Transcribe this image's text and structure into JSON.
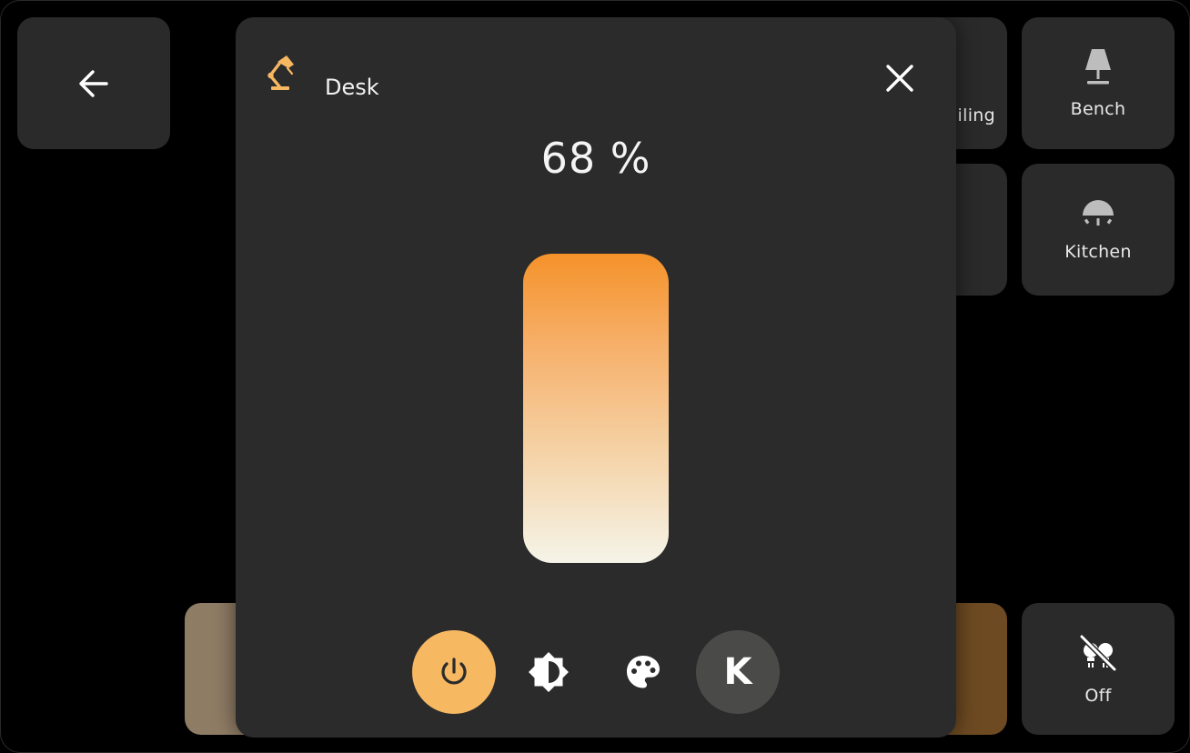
{
  "background_tiles": {
    "ceiling_label_partial": "iling",
    "bench_label": "Bench",
    "kitchen_label": "Kitchen",
    "off_label": "Off"
  },
  "modal": {
    "title": "Desk",
    "brightness_text": "68 %",
    "brightness_percent": 68,
    "icon": "desk-lamp-icon"
  },
  "controls": {
    "kelvin_label": "K"
  },
  "colors": {
    "accent": "#f7b862",
    "slider_top": "#f5922a",
    "slider_bottom": "#f5f4e8",
    "tile_bg": "#2a2a2a",
    "modal_bg": "#2b2b2b",
    "kelvin_btn_bg": "#4a4b49",
    "left_bottom_tile": "#8f7c65",
    "right_bottom_tile": "#6d4a22"
  }
}
